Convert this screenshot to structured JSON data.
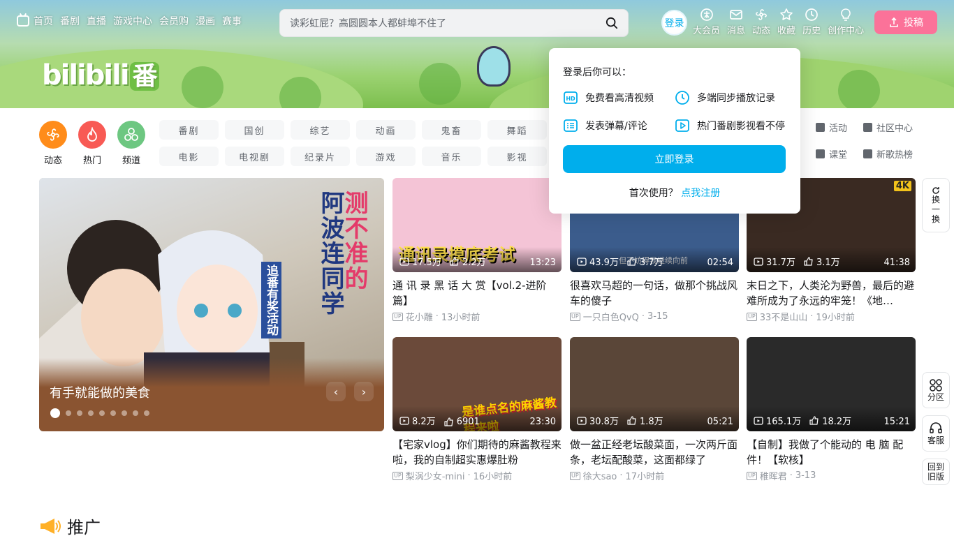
{
  "nav": {
    "items": [
      "首页",
      "番剧",
      "直播",
      "游戏中心",
      "会员购",
      "漫画",
      "赛事"
    ]
  },
  "search": {
    "placeholder": "读彩虹屁？高圆圆本人都蚌埠不住了"
  },
  "login_label": "登录",
  "right_nav": [
    {
      "label": "大会员",
      "icon": "vip-icon"
    },
    {
      "label": "消息",
      "icon": "mail-icon"
    },
    {
      "label": "动态",
      "icon": "wind-icon"
    },
    {
      "label": "收藏",
      "icon": "star-icon"
    },
    {
      "label": "历史",
      "icon": "clock-icon"
    },
    {
      "label": "创作中心",
      "icon": "bulb-icon"
    }
  ],
  "upload_label": "投稿",
  "logo": {
    "text": "bilibili",
    "badge": "番"
  },
  "channels": [
    {
      "label": "动态",
      "color": "#ff8c1a"
    },
    {
      "label": "热门",
      "color": "#f85a54"
    },
    {
      "label": "频道",
      "color": "#6dc781"
    }
  ],
  "tags": [
    "番剧",
    "国创",
    "综艺",
    "动画",
    "鬼畜",
    "舞蹈",
    "电影",
    "电视剧",
    "纪录片",
    "游戏",
    "音乐",
    "影视"
  ],
  "side_links": [
    "活动",
    "社区中心",
    "课堂",
    "新歌热榜"
  ],
  "carousel": {
    "caption": "有手就能做的美食",
    "overlay_text_1": "阿波连同学",
    "overlay_text_2": "测不准的",
    "overlay_text_3": "追番有奖活动",
    "dot_count": 9,
    "active_dot": 0
  },
  "videos": [
    {
      "title": "通 讯 录 黑 话 大 赏【vol.2-进阶篇】",
      "author": "花小雕",
      "time": "13小时前",
      "plays": "17.5万",
      "likes": "2.2万",
      "duration": "13:23",
      "thumb_color": "#f4c4d6",
      "thumb_text": "通讯录摸底考试"
    },
    {
      "title": "很喜欢马超的一句话，做那个挑战风车的傻子",
      "author": "一只白色QvQ",
      "time": "3-15",
      "plays": "43.9万",
      "likes": "3.7万",
      "duration": "02:54",
      "thumb_color": "#3b5c8c",
      "thumb_text": "但不妨碍我继续向前"
    },
    {
      "title": "末日之下，人类沦为野兽，最后的避难所成为了永远的牢笼！《地…",
      "author": "33不是山山",
      "time": "19小时前",
      "plays": "31.7万",
      "likes": "3.1万",
      "duration": "41:38",
      "thumb_color": "#3a2a22",
      "thumb_text": "4K"
    },
    {
      "title": "【宅家vlog】你们期待的麻酱教程来啦，我的自制超实惠爆肚粉",
      "author": "梨涡少女-mini",
      "time": "16小时前",
      "plays": "8.2万",
      "likes": "6901",
      "duration": "23:30",
      "thumb_color": "#6b4a3a",
      "thumb_text": "是谁点名的麻酱教程来啦"
    },
    {
      "title": "做一盆正经老坛酸菜面，一次两斤面条，老坛配酸菜，这面都绿了",
      "author": "徐大sao",
      "time": "17小时前",
      "plays": "30.8万",
      "likes": "1.8万",
      "duration": "05:21",
      "thumb_color": "#5a4638",
      "thumb_text": ""
    },
    {
      "title": "【自制】我做了个能动的 电 脑 配件！【软核】",
      "author": "稚晖君",
      "time": "3-13",
      "plays": "165.1万",
      "likes": "18.2万",
      "duration": "15:21",
      "thumb_color": "#2a2a2a",
      "thumb_text": ""
    }
  ],
  "popup": {
    "head": "登录后你可以：",
    "features": [
      {
        "label": "免费看高清视频",
        "icon": "hd-icon"
      },
      {
        "label": "多端同步播放记录",
        "icon": "clock-icon"
      },
      {
        "label": "发表弹幕/评论",
        "icon": "comment-list-icon"
      },
      {
        "label": "热门番剧影视看不停",
        "icon": "play-icon"
      }
    ],
    "button": "立即登录",
    "first_use": "首次使用？",
    "register": "点我注册"
  },
  "float": {
    "refresh": [
      "换",
      "一",
      "换"
    ],
    "zone": "分区",
    "service": "客服",
    "old_version": "回到旧版"
  },
  "promo": {
    "title": "推广"
  },
  "colors": {
    "accent": "#00aeec",
    "pink": "#fb7299"
  }
}
